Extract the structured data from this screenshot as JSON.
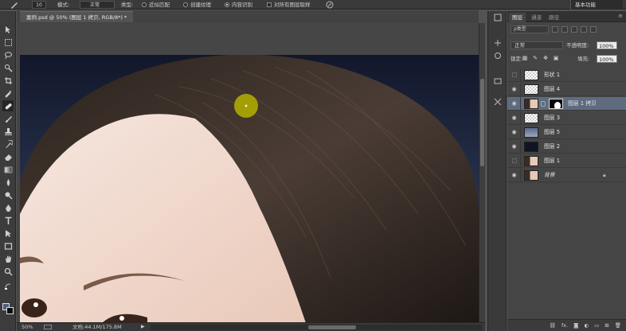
{
  "options_bar": {
    "brush_size": "10",
    "mode_label": "模式:",
    "mode_value": "正常",
    "type_label": "类型:",
    "type_options": [
      "近似匹配",
      "创建纹理",
      "内容识别"
    ],
    "type_selected": "内容识别",
    "sample_all_label": "对所有图层取样",
    "workspace": "基本功能"
  },
  "document": {
    "tab_title": "案例.psd @ 50% (图层 1 拷贝, RGB/8*) *",
    "zoom": "50%",
    "doc_info": "文档:44.1M/175.8M"
  },
  "layers_panel": {
    "tabs": [
      "图层",
      "通道",
      "路径"
    ],
    "active_tab": "图层",
    "kind_filter": "ρ类型",
    "blend_mode": "正常",
    "opacity_label": "不透明度:",
    "opacity_value": "100%",
    "lock_label": "锁定:",
    "fill_label": "填充:",
    "fill_value": "100%",
    "layers": [
      {
        "name": "形状 1",
        "visible": false,
        "thumb": "checker",
        "selected": false
      },
      {
        "name": "图层 4",
        "visible": true,
        "thumb": "checker",
        "selected": false
      },
      {
        "name": "图层 1 拷贝",
        "visible": true,
        "thumb": "face",
        "selected": true,
        "has_mask": true
      },
      {
        "name": "图层 3",
        "visible": true,
        "thumb": "checker",
        "selected": false
      },
      {
        "name": "图层 5",
        "visible": true,
        "thumb": "blue",
        "selected": false
      },
      {
        "name": "图层 2",
        "visible": true,
        "thumb": "dark",
        "selected": false
      },
      {
        "name": "图层 1",
        "visible": false,
        "thumb": "face",
        "selected": false
      },
      {
        "name": "背景",
        "visible": true,
        "thumb": "face",
        "selected": false,
        "locked": true
      }
    ],
    "bottom_icons": [
      "link-icon",
      "fx-icon",
      "mask-icon",
      "adjustment-icon",
      "group-icon",
      "new-layer-icon",
      "trash-icon"
    ],
    "bottom_fx": "fx."
  },
  "colors": {
    "foreground": "#4e5f7c",
    "background": "#0c0c0c",
    "brush_cursor": "#b5b000"
  }
}
